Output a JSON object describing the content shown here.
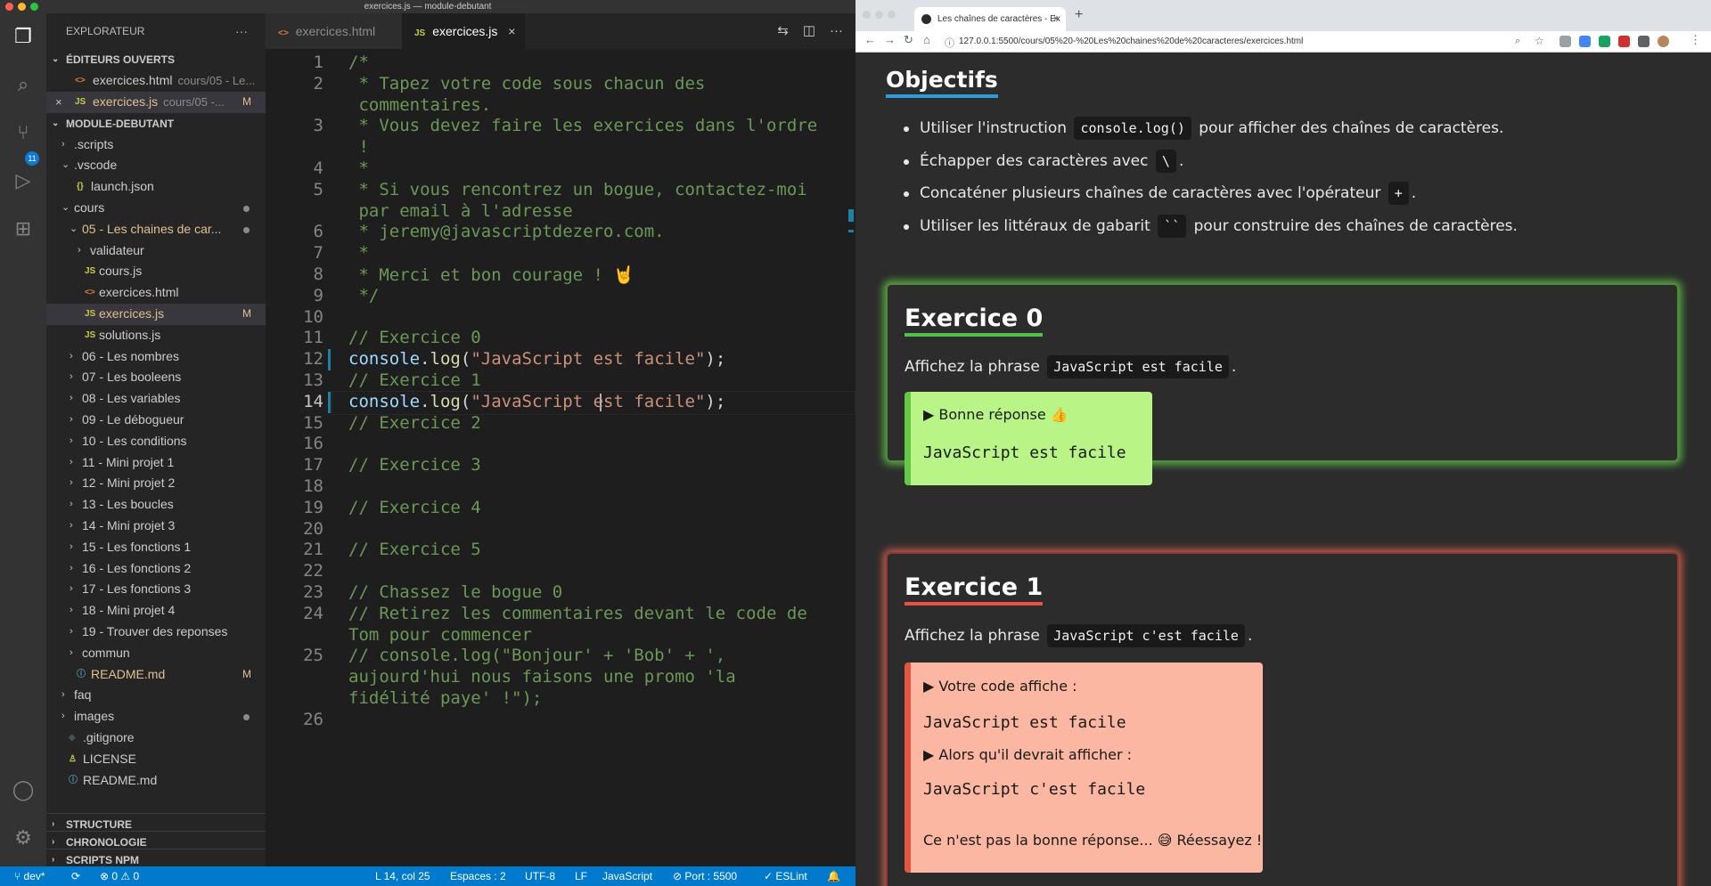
{
  "vscode": {
    "window_title": "exercices.js — module-debutant",
    "sidebar": {
      "title": "EXPLORATEUR",
      "open_editors_label": "ÉDITEURS OUVERTS",
      "open_editors": [
        {
          "name": "exercices.html",
          "desc": "cours/05 - Le...",
          "icon": "<>"
        },
        {
          "name": "exercices.js",
          "desc": "cours/05 -...",
          "icon": "JS",
          "status": "M"
        }
      ],
      "project_label": "MODULE-DEBUTANT",
      "tree": [
        {
          "label": ".scripts",
          "chev": "›",
          "icon": ""
        },
        {
          "label": ".vscode",
          "chev": "⌄",
          "icon": ""
        },
        {
          "label": "launch.json",
          "chev": "",
          "icon": "{}"
        },
        {
          "label": "cours",
          "chev": "⌄",
          "icon": ""
        },
        {
          "label": "05 - Les chaines de car...",
          "chev": "⌄",
          "icon": ""
        },
        {
          "label": "validateur",
          "chev": "›",
          "icon": ""
        },
        {
          "label": "cours.js",
          "chev": "",
          "icon": "JS"
        },
        {
          "label": "exercices.html",
          "chev": "",
          "icon": "<>"
        },
        {
          "label": "exercices.js",
          "chev": "",
          "icon": "JS",
          "status": "M"
        },
        {
          "label": "solutions.js",
          "chev": "",
          "icon": "JS"
        },
        {
          "label": "06 - Les nombres",
          "chev": "›",
          "icon": ""
        },
        {
          "label": "07 - Les booleens",
          "chev": "›",
          "icon": ""
        },
        {
          "label": "08 - Les variables",
          "chev": "›",
          "icon": ""
        },
        {
          "label": "09 - Le débogueur",
          "chev": "›",
          "icon": ""
        },
        {
          "label": "10 - Les conditions",
          "chev": "›",
          "icon": ""
        },
        {
          "label": "11 - Mini projet 1",
          "chev": "›",
          "icon": ""
        },
        {
          "label": "12 - Mini projet 2",
          "chev": "›",
          "icon": ""
        },
        {
          "label": "13 - Les boucles",
          "chev": "›",
          "icon": ""
        },
        {
          "label": "14 - Mini projet 3",
          "chev": "›",
          "icon": ""
        },
        {
          "label": "15 - Les fonctions 1",
          "chev": "›",
          "icon": ""
        },
        {
          "label": "16 - Les fonctions 2",
          "chev": "›",
          "icon": ""
        },
        {
          "label": "17 - Les fonctions 3",
          "chev": "›",
          "icon": ""
        },
        {
          "label": "18 - Mini projet 4",
          "chev": "›",
          "icon": ""
        },
        {
          "label": "19 - Trouver des reponses",
          "chev": "›",
          "icon": ""
        },
        {
          "label": "commun",
          "chev": "›",
          "icon": ""
        },
        {
          "label": "README.md",
          "chev": "",
          "icon": "ⓘ",
          "status": "M"
        },
        {
          "label": "faq",
          "chev": "›",
          "icon": ""
        },
        {
          "label": "images",
          "chev": "›",
          "icon": ""
        },
        {
          "label": ".gitignore",
          "chev": "",
          "icon": "◆"
        },
        {
          "label": "LICENSE",
          "chev": "",
          "icon": "♙"
        },
        {
          "label": "README.md",
          "chev": "",
          "icon": "ⓘ"
        }
      ],
      "bottom_sections": [
        "STRUCTURE",
        "CHRONOLOGIE",
        "SCRIPTS NPM"
      ]
    },
    "tabs": [
      {
        "label": "exercices.html",
        "icon": "<>"
      },
      {
        "label": "exercices.js",
        "icon": "JS",
        "close": "×"
      }
    ],
    "line_numbers": [
      "1",
      "2",
      "",
      "3",
      "",
      "4",
      "5",
      "",
      "6",
      "7",
      "8",
      "9",
      "10",
      "11",
      "12",
      "13",
      "14",
      "15",
      "16",
      "17",
      "18",
      "19",
      "20",
      "21",
      "22",
      "23",
      "24",
      "",
      "25",
      "",
      "",
      "26"
    ],
    "code_lines": [
      "/*",
      " * Tapez votre code sous chacun des",
      " commentaires.",
      " * Vous devez faire les exercices dans l'ordre",
      " !",
      " *",
      " * Si vous rencontrez un bogue, contactez-moi",
      " par email à l'adresse",
      " * jeremy@javascriptdezero.com.",
      " *",
      " * Merci et bon courage ! 🤘",
      " */",
      "",
      "// Exercice 0",
      "",
      "// Exercice 1",
      "",
      "// Exercice 2",
      "",
      "// Exercice 3",
      "",
      "// Exercice 4",
      "",
      "// Exercice 5",
      "",
      "// Chassez le bogue 0",
      "// Retirez les commentaires devant le code de",
      "Tom pour commencer",
      "// console.log(\"Bonjour' + 'Bob' + ',",
      "aujourd'hui nous faisons une promo 'la",
      "fidélité paye' !\");",
      ""
    ],
    "code_line_12": {
      "obj": "console",
      "dot": ".",
      "fn": "log",
      "open": "(",
      "str": "\"JavaScript est facile\"",
      "close": ");"
    },
    "code_line_14": {
      "obj": "console",
      "dot": ".",
      "fn": "log",
      "open": "(",
      "str": "\"JavaScript est facile\"",
      "close": ");"
    },
    "statusbar": {
      "branch": "dev*",
      "sync": "⟳",
      "problems": "⊗ 0 ⚠ 0",
      "position": "L 14, col 25",
      "spaces": "Espaces : 2",
      "encoding": "UTF-8",
      "eol": "LF",
      "language": "JavaScript",
      "port": "⊘ Port : 5500",
      "eslint": "✓ ESLint",
      "bell": "🔔"
    }
  },
  "browser": {
    "tab_title": "Les chaînes de caractères - Ex",
    "tab_close": "×",
    "new_tab": "+",
    "url": "127.0.0.1:5500/cours/05%20-%20Les%20chaines%20de%20caracteres/exercices.html",
    "page": {
      "objectives_title": "Objectifs",
      "objectives": [
        {
          "before": "Utiliser l'instruction",
          "code": "console.log()",
          "after": "pour afficher des chaînes de caractères."
        },
        {
          "before": "Échapper des caractères avec",
          "code": "\\",
          "after": "."
        },
        {
          "before": "Concaténer plusieurs chaînes de caractères avec l'opérateur",
          "code": "+",
          "after": "."
        },
        {
          "before": "Utiliser les littéraux de gabarit",
          "code": "``",
          "after": "pour construire des chaînes de caractères."
        }
      ],
      "ex0": {
        "title": "Exercice 0",
        "desc_before": "Affichez la phrase",
        "desc_code": "JavaScript est facile",
        "desc_after": ".",
        "result_label": "▶ Bonne réponse 👍",
        "result_value": "JavaScript est facile"
      },
      "ex1": {
        "title": "Exercice 1",
        "desc_before": "Affichez la phrase",
        "desc_code": "JavaScript c'est facile",
        "desc_after": ".",
        "got_label": "▶ Votre code affiche :",
        "got_value": "JavaScript est facile",
        "expected_label": "▶ Alors qu'il devrait afficher :",
        "expected_value": "JavaScript c'est facile",
        "message": "Ce n'est pas la bonne réponse... 😅 Réessayez !"
      }
    }
  }
}
